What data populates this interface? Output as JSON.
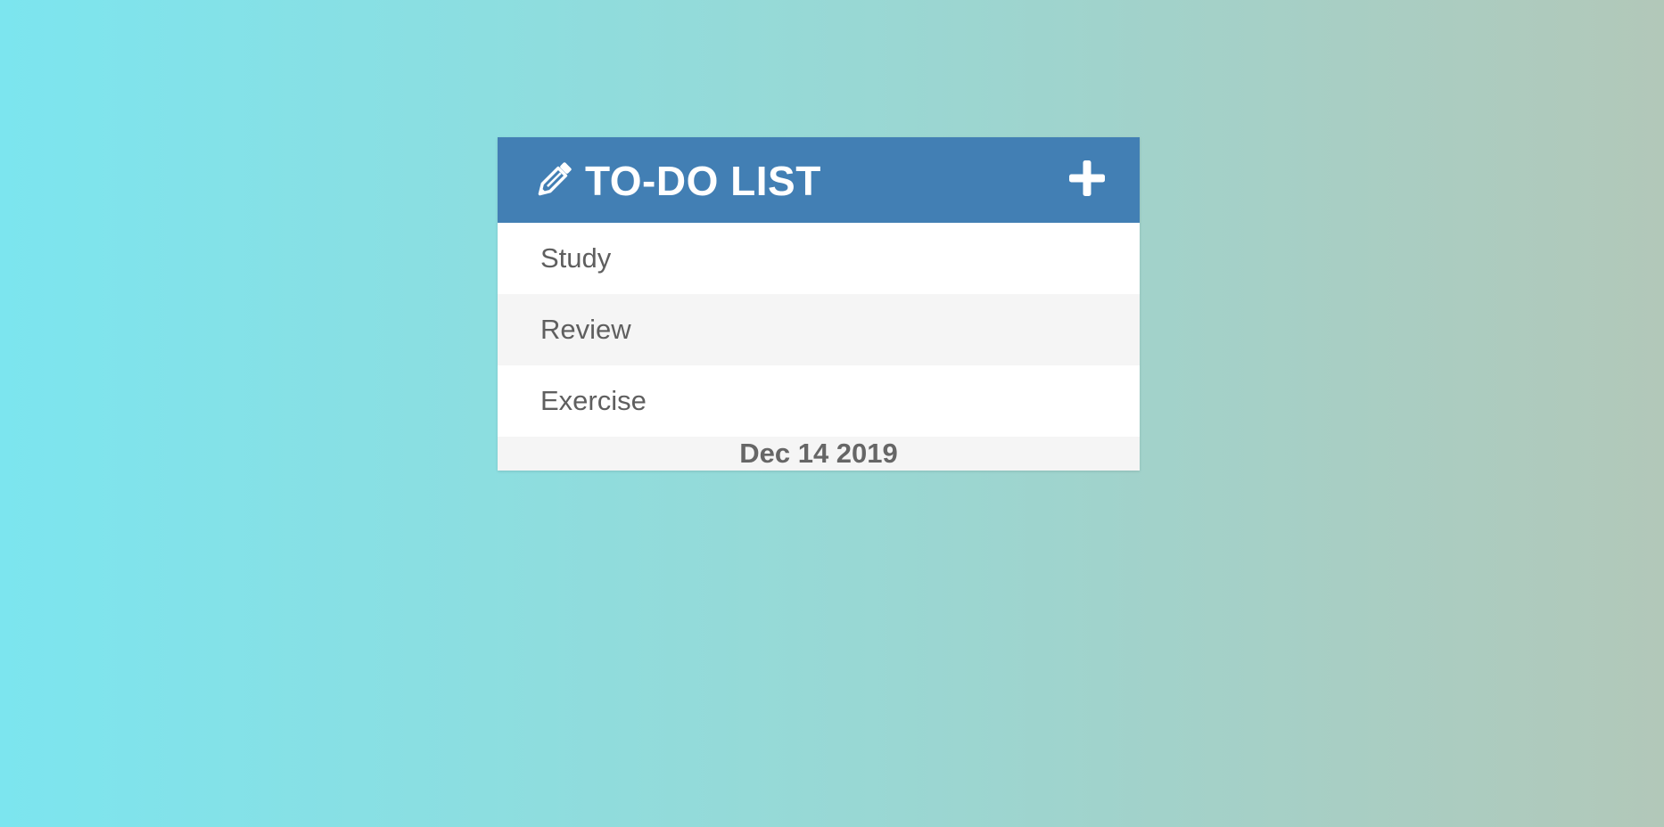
{
  "header": {
    "icon": "pencil-icon",
    "title": "TO-DO LIST",
    "add_icon": "plus-icon",
    "color": "#427fb4"
  },
  "todos": [
    {
      "label": "Study"
    },
    {
      "label": "Review"
    },
    {
      "label": "Exercise"
    }
  ],
  "footer": {
    "date": "Dec 14 2019"
  },
  "colors": {
    "background_start": "#7ce5ef",
    "background_end": "#b2c8b9",
    "text": "#5f5f5f"
  }
}
